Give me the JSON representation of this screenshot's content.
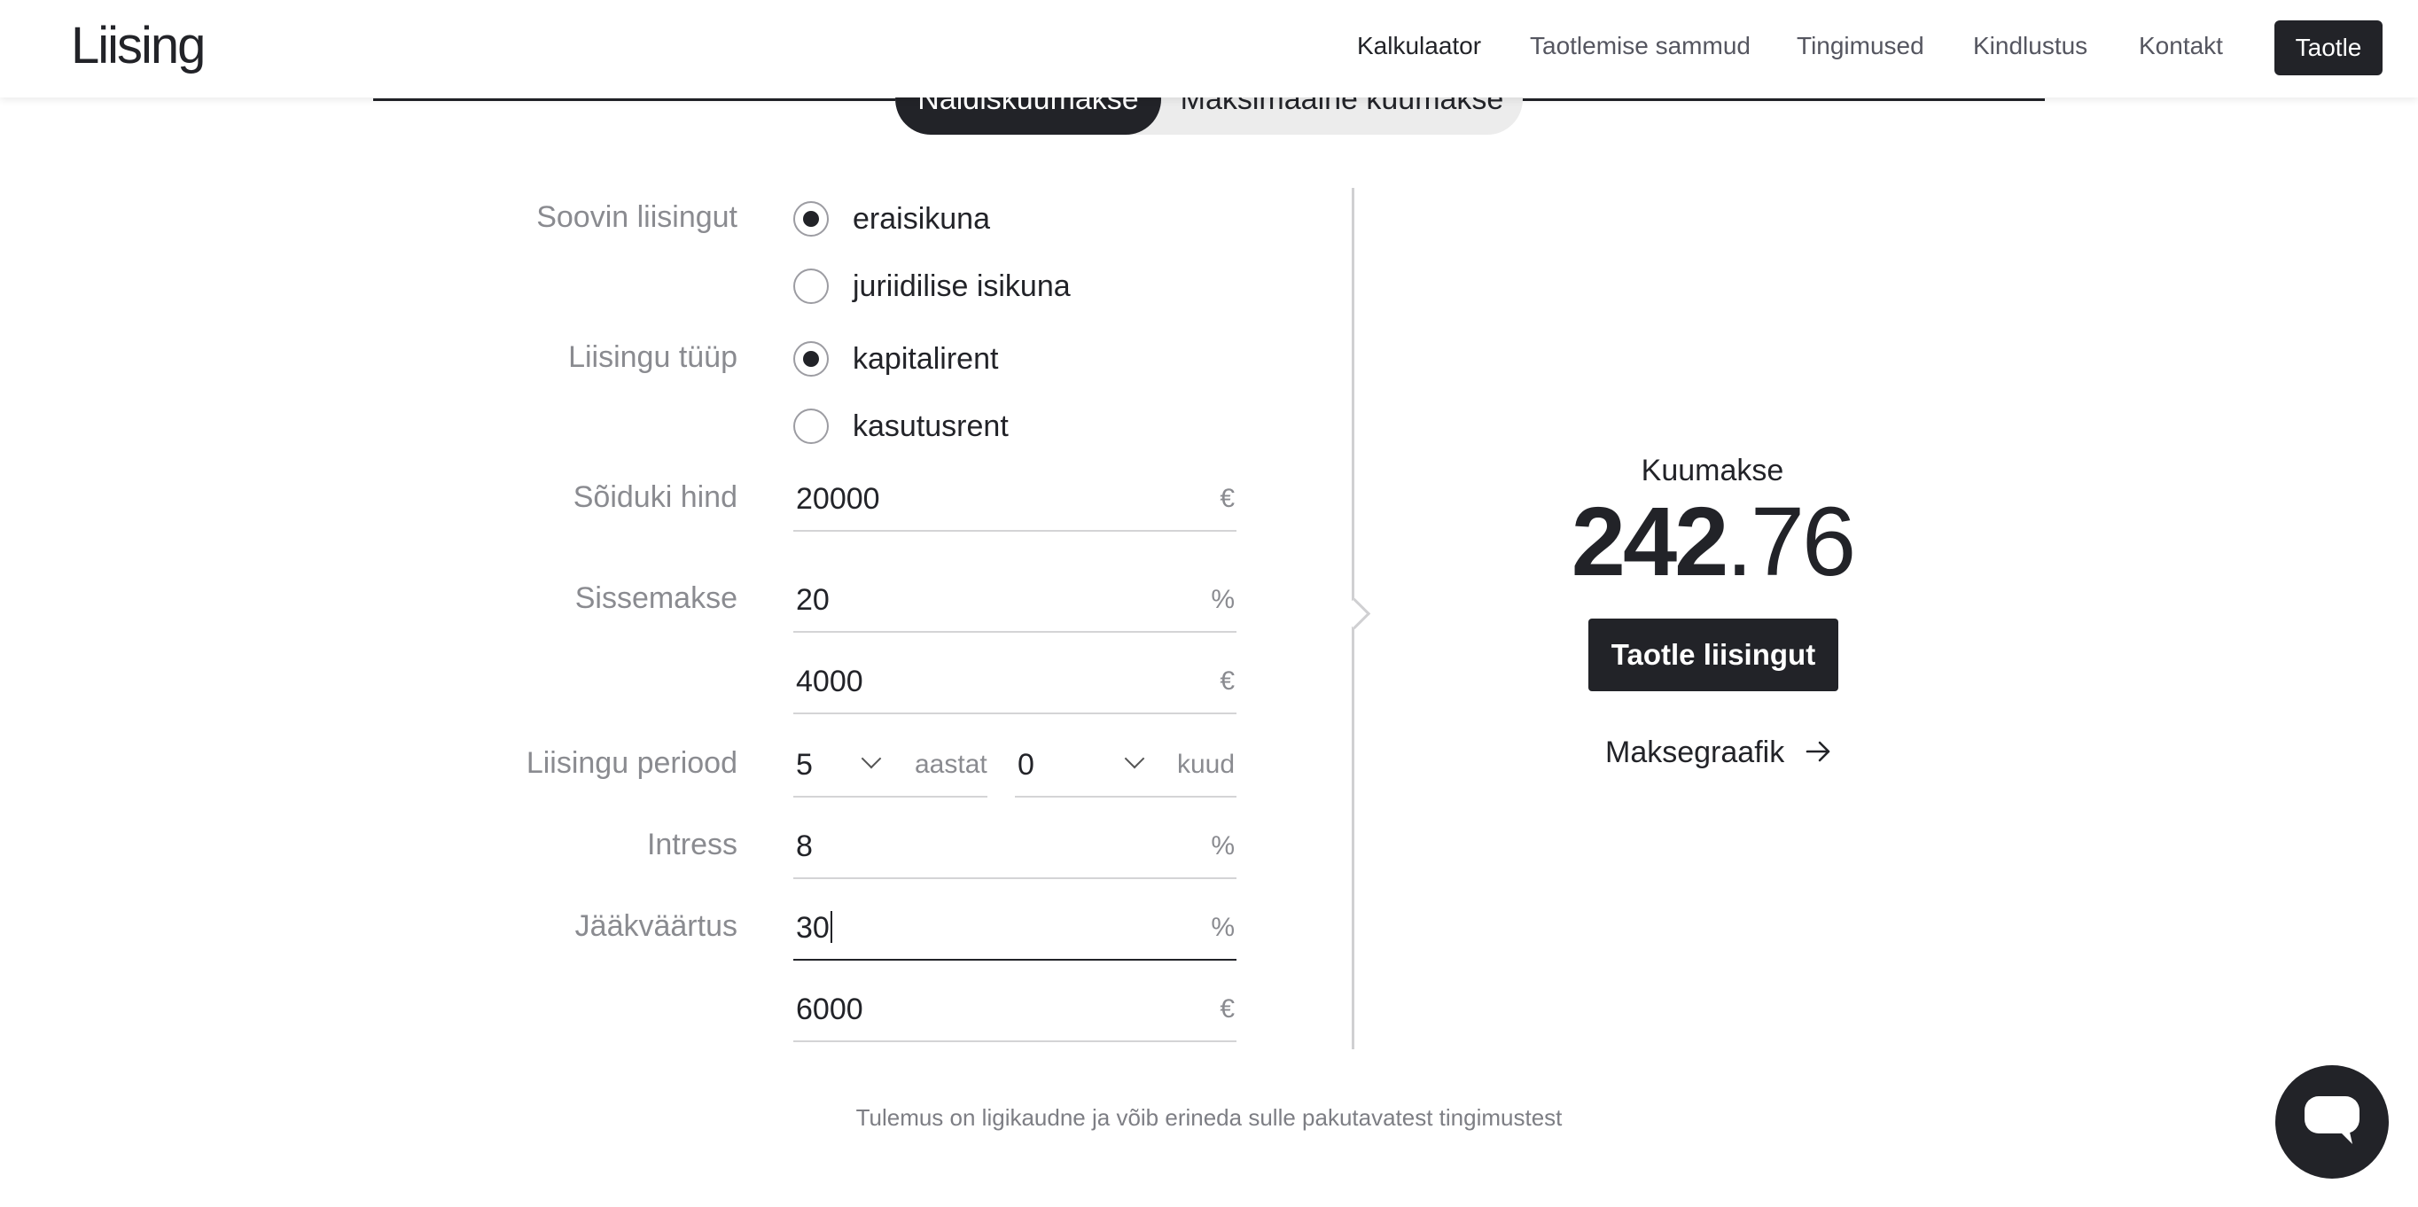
{
  "header": {
    "logo": "Liising",
    "nav": [
      "Kalkulaator",
      "Taotlemise sammud",
      "Tingimused",
      "Kindlustus",
      "Kontakt"
    ],
    "cta": "Taotle"
  },
  "tabs": {
    "sample": "Näidiskuumakse",
    "maximum": "Maksimaalne kuumakse"
  },
  "form": {
    "applicant_label": "Soovin liisingut",
    "applicant_options": [
      "eraisikuna",
      "juriidilise isikuna"
    ],
    "applicant_selected": "eraisikuna",
    "type_label": "Liisingu tüüp",
    "type_options": [
      "kapitalirent",
      "kasutusrent"
    ],
    "type_selected": "kapitalirent",
    "price_label": "Sõiduki hind",
    "price_value": "20000",
    "price_unit": "€",
    "down_label": "Sissemakse",
    "down_percent": "20",
    "down_percent_unit": "%",
    "down_amount": "4000",
    "down_amount_unit": "€",
    "period_label": "Liisingu periood",
    "period_years": "5",
    "period_years_unit": "aastat",
    "period_months": "0",
    "period_months_unit": "kuud",
    "interest_label": "Intress",
    "interest_value": "8",
    "interest_unit": "%",
    "residual_label": "Jääkväärtus",
    "residual_percent": "30",
    "residual_percent_unit": "%",
    "residual_amount": "6000",
    "residual_amount_unit": "€"
  },
  "result": {
    "label": "Kuumakse",
    "value_int": "242",
    "value_dec": ".76",
    "apply_button": "Taotle liisingut",
    "schedule_link": "Maksegraafik"
  },
  "note": "Tulemus on ligikaudne ja võib erineda sulle pakutavatest tingimustest",
  "icons": {
    "schedule_arrow": "arrow-right-icon",
    "chat": "chat-bubble-icon"
  }
}
